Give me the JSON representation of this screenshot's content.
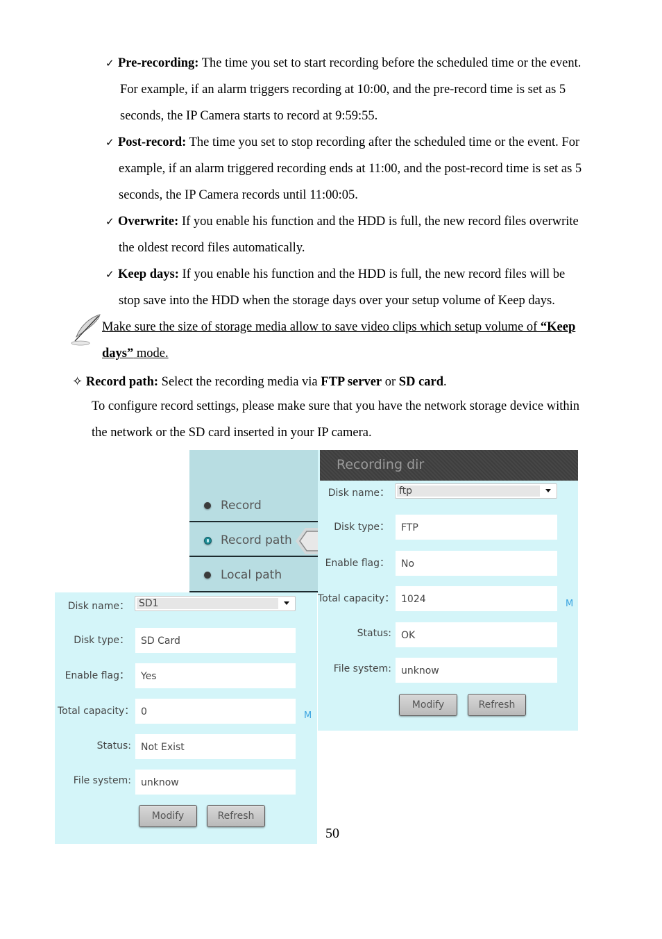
{
  "bullets": [
    {
      "term": "Pre-recording:",
      "lines": [
        "The time you set to start recording before the scheduled time or the event.",
        "For example, if an alarm triggers recording at 10:00, and the pre-record time is set as 5",
        "seconds, the IP Camera starts to record at 9:59:55."
      ]
    },
    {
      "term": "Post-record:",
      "lines": [
        "The time you set to stop recording after the scheduled time or the event. For",
        "example, if an alarm triggered recording ends at 11:00, and the post-record time is set as 5",
        "seconds, the IP Camera records until 11:00:05."
      ]
    },
    {
      "term": "Overwrite:",
      "lines": [
        "If you enable his function and the HDD is full, the new record files overwrite",
        "the oldest record files automatically."
      ]
    },
    {
      "term": "Keep days:",
      "lines": [
        "If you enable his function and the HDD is full, the new record files will be",
        "stop save into the HDD when the storage days over your setup volume of Keep days."
      ]
    }
  ],
  "check_glyph": "✓",
  "note": {
    "icon": "feather-pen-icon",
    "line1_text": "Make sure the size of storage media allow to save video clips which setup volume of ",
    "line1_bold": "“Keep ",
    "line2_bold": "days”",
    "line2_text": " mode."
  },
  "record_path": {
    "glyph": "✧",
    "term": "Record path:",
    "text1": " Select the recording media via ",
    "bold1": "FTP server",
    "text2": " or ",
    "bold2": "SD card",
    "text3": ".",
    "para_lines": [
      "To configure record settings, please make sure that you have the network storage device within",
      "the network or the SD card inserted in your IP camera."
    ]
  },
  "nav": {
    "items": [
      {
        "label": "Record",
        "active": false
      },
      {
        "label": "Record path",
        "active": true
      },
      {
        "label": "Local path",
        "active": false
      }
    ]
  },
  "ftp_panel": {
    "title": "Recording dir",
    "disk_name_label": "Disk name：",
    "disk_name_value": "ftp",
    "disk_type_label": "Disk type：",
    "disk_type_value": "FTP",
    "enable_flag_label": "Enable flag：",
    "enable_flag_value": "No",
    "total_capacity_label": "Total capacity：",
    "total_capacity_value": "1024",
    "unit": "M",
    "status_label": "Status:",
    "status_value": "OK",
    "file_system_label": "File system:",
    "file_system_value": "unknow",
    "modify_label": "Modify",
    "refresh_label": "Refresh"
  },
  "sd_panel": {
    "disk_name_label": "Disk name：",
    "disk_name_value": "SD1",
    "disk_type_label": "Disk type：",
    "disk_type_value": "SD Card",
    "enable_flag_label": "Enable flag：",
    "enable_flag_value": "Yes",
    "total_capacity_label": "Total capacity：",
    "total_capacity_value": "0",
    "unit": "M",
    "status_label": "Status:",
    "status_value": "Not Exist",
    "file_system_label": "File system:",
    "file_system_value": "unknow",
    "modify_label": "Modify",
    "refresh_label": "Refresh"
  },
  "page_number": "50"
}
